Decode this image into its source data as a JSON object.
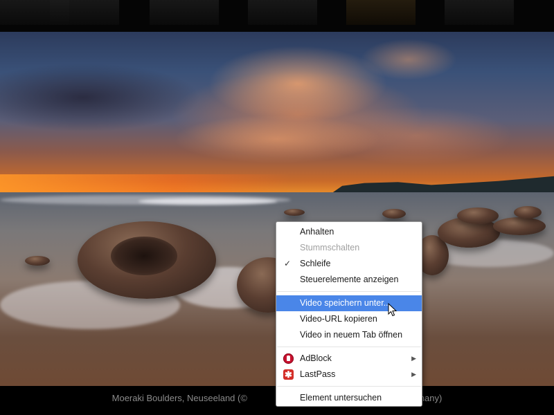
{
  "caption": {
    "left": "Moeraki Boulders, Neuseeland (© ",
    "right": "Germany)"
  },
  "context_menu": {
    "items": [
      {
        "label": "Anhalten",
        "state": "enabled"
      },
      {
        "label": "Stummschalten",
        "state": "disabled"
      },
      {
        "label": "Schleife",
        "state": "checked"
      },
      {
        "label": "Steuerelemente anzeigen",
        "state": "enabled"
      },
      {
        "label": "Video speichern unter...",
        "state": "highlighted"
      },
      {
        "label": "Video-URL kopieren",
        "state": "enabled"
      },
      {
        "label": "Video in neuem Tab öffnen",
        "state": "enabled"
      },
      {
        "label": "AdBlock",
        "icon": "adblock-icon",
        "submenu": true
      },
      {
        "label": "LastPass",
        "icon": "lastpass-icon",
        "submenu": true
      },
      {
        "label": "Element untersuchen",
        "state": "enabled"
      }
    ],
    "check_glyph": "✓",
    "submenu_glyph": "▶",
    "lastpass_glyph": "✱"
  },
  "colors": {
    "highlight": "#4a86e8",
    "adblock": "#c8102e",
    "lastpass": "#d32d27"
  }
}
